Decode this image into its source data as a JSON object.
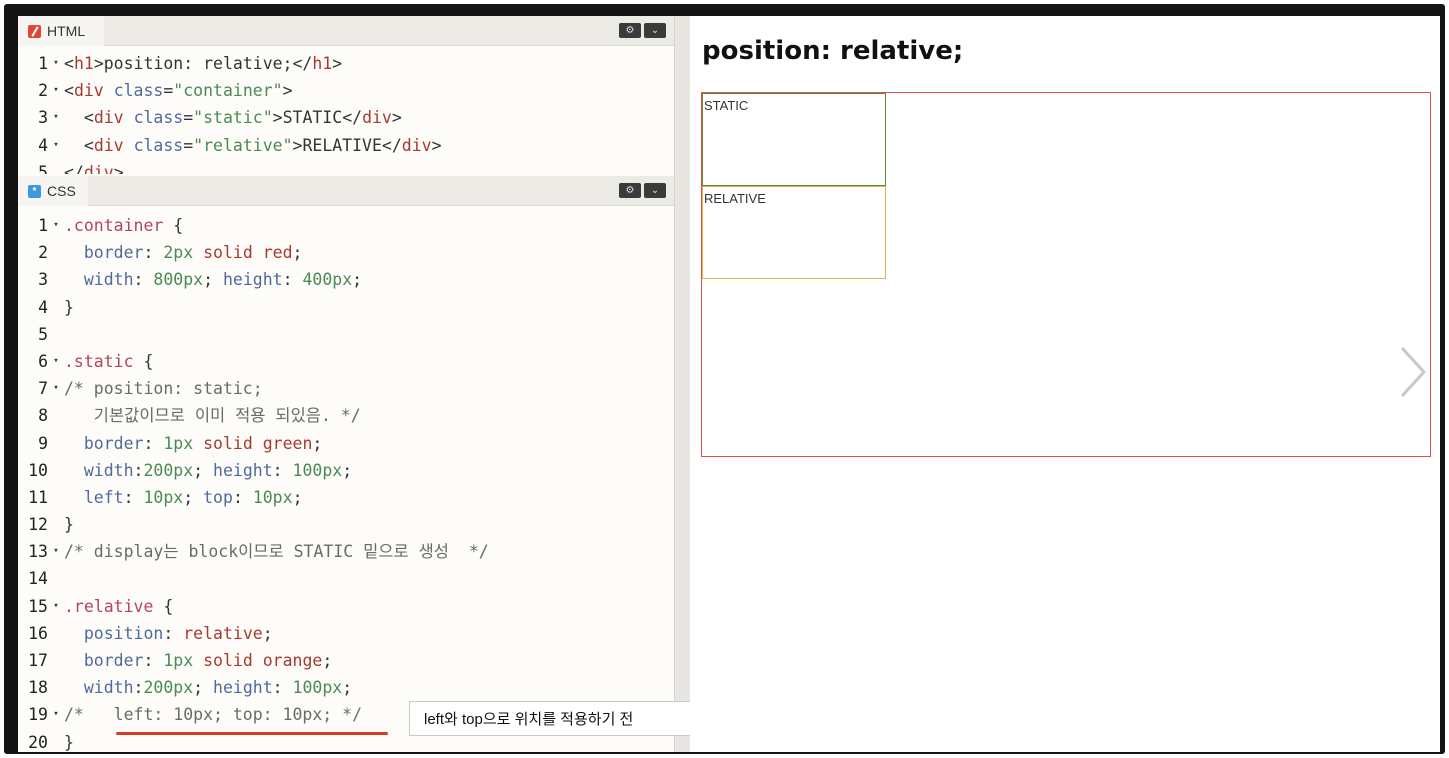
{
  "html_pane": {
    "tab_label": "HTML",
    "lines": [
      {
        "n": "1",
        "fold": "▾",
        "tokens": [
          [
            "t-plain",
            "<"
          ],
          [
            "t-tag",
            "h1"
          ],
          [
            "t-plain",
            ">position: relative;</"
          ],
          [
            "t-tag",
            "h1"
          ],
          [
            "t-plain",
            ">"
          ]
        ]
      },
      {
        "n": "2",
        "fold": "▾",
        "tokens": [
          [
            "t-plain",
            "<"
          ],
          [
            "t-tag",
            "div"
          ],
          [
            "t-plain",
            " "
          ],
          [
            "t-attr",
            "class"
          ],
          [
            "t-plain",
            "="
          ],
          [
            "t-str",
            "\"container\""
          ],
          [
            "t-plain",
            ">"
          ]
        ]
      },
      {
        "n": "3",
        "fold": "▾",
        "tokens": [
          [
            "t-plain",
            "  <"
          ],
          [
            "t-tag",
            "div"
          ],
          [
            "t-plain",
            " "
          ],
          [
            "t-attr",
            "class"
          ],
          [
            "t-plain",
            "="
          ],
          [
            "t-str",
            "\"static\""
          ],
          [
            "t-plain",
            ">STATIC</"
          ],
          [
            "t-tag",
            "div"
          ],
          [
            "t-plain",
            ">"
          ]
        ]
      },
      {
        "n": "4",
        "fold": "▾",
        "tokens": [
          [
            "t-plain",
            "  <"
          ],
          [
            "t-tag",
            "div"
          ],
          [
            "t-plain",
            " "
          ],
          [
            "t-attr",
            "class"
          ],
          [
            "t-plain",
            "="
          ],
          [
            "t-str",
            "\"relative\""
          ],
          [
            "t-plain",
            ">RELATIVE</"
          ],
          [
            "t-tag",
            "div"
          ],
          [
            "t-plain",
            ">"
          ]
        ]
      },
      {
        "n": "5",
        "fold": "",
        "tokens": [
          [
            "t-plain",
            "</"
          ],
          [
            "t-tag",
            "div"
          ],
          [
            "t-plain",
            ">"
          ]
        ]
      }
    ]
  },
  "css_pane": {
    "tab_label": "CSS",
    "lines": [
      {
        "n": "1",
        "fold": "▾",
        "tokens": [
          [
            "t-sel",
            ".container"
          ],
          [
            "t-plain",
            " {"
          ]
        ]
      },
      {
        "n": "2",
        "fold": "",
        "tokens": [
          [
            "t-plain",
            "  "
          ],
          [
            "t-prop",
            "border"
          ],
          [
            "t-plain",
            ": "
          ],
          [
            "t-num",
            "2px"
          ],
          [
            "t-plain",
            " "
          ],
          [
            "t-kw",
            "solid"
          ],
          [
            "t-plain",
            " "
          ],
          [
            "t-kw",
            "red"
          ],
          [
            "t-plain",
            ";"
          ]
        ]
      },
      {
        "n": "3",
        "fold": "",
        "tokens": [
          [
            "t-plain",
            "  "
          ],
          [
            "t-prop",
            "width"
          ],
          [
            "t-plain",
            ": "
          ],
          [
            "t-num",
            "800px"
          ],
          [
            "t-plain",
            "; "
          ],
          [
            "t-prop",
            "height"
          ],
          [
            "t-plain",
            ": "
          ],
          [
            "t-num",
            "400px"
          ],
          [
            "t-plain",
            ";"
          ]
        ]
      },
      {
        "n": "4",
        "fold": "",
        "tokens": [
          [
            "t-plain",
            "}"
          ]
        ]
      },
      {
        "n": "5",
        "fold": "",
        "tokens": []
      },
      {
        "n": "6",
        "fold": "▾",
        "tokens": [
          [
            "t-sel",
            ".static"
          ],
          [
            "t-plain",
            " {"
          ]
        ]
      },
      {
        "n": "7",
        "fold": "▾",
        "tokens": [
          [
            "t-com",
            "/* position: static;"
          ]
        ]
      },
      {
        "n": "8",
        "fold": "",
        "tokens": [
          [
            "t-com",
            "   기본값이므로 이미 적용 되있음. */"
          ]
        ]
      },
      {
        "n": "9",
        "fold": "",
        "tokens": [
          [
            "t-plain",
            "  "
          ],
          [
            "t-prop",
            "border"
          ],
          [
            "t-plain",
            ": "
          ],
          [
            "t-num",
            "1px"
          ],
          [
            "t-plain",
            " "
          ],
          [
            "t-kw",
            "solid"
          ],
          [
            "t-plain",
            " "
          ],
          [
            "t-kw",
            "green"
          ],
          [
            "t-plain",
            ";"
          ]
        ]
      },
      {
        "n": "10",
        "fold": "",
        "tokens": [
          [
            "t-plain",
            "  "
          ],
          [
            "t-prop",
            "width"
          ],
          [
            "t-plain",
            ":"
          ],
          [
            "t-num",
            "200px"
          ],
          [
            "t-plain",
            "; "
          ],
          [
            "t-prop",
            "height"
          ],
          [
            "t-plain",
            ": "
          ],
          [
            "t-num",
            "100px"
          ],
          [
            "t-plain",
            ";"
          ]
        ]
      },
      {
        "n": "11",
        "fold": "",
        "tokens": [
          [
            "t-plain",
            "  "
          ],
          [
            "t-prop",
            "left"
          ],
          [
            "t-plain",
            ": "
          ],
          [
            "t-num",
            "10px"
          ],
          [
            "t-plain",
            "; "
          ],
          [
            "t-prop",
            "top"
          ],
          [
            "t-plain",
            ": "
          ],
          [
            "t-num",
            "10px"
          ],
          [
            "t-plain",
            ";"
          ]
        ]
      },
      {
        "n": "12",
        "fold": "",
        "tokens": [
          [
            "t-plain",
            "}"
          ]
        ]
      },
      {
        "n": "13",
        "fold": "▾",
        "tokens": [
          [
            "t-com",
            "/* display는 block이므로 STATIC 밑으로 생성  */"
          ]
        ]
      },
      {
        "n": "14",
        "fold": "",
        "tokens": []
      },
      {
        "n": "15",
        "fold": "▾",
        "tokens": [
          [
            "t-sel",
            ".relative"
          ],
          [
            "t-plain",
            " {"
          ]
        ]
      },
      {
        "n": "16",
        "fold": "",
        "tokens": [
          [
            "t-plain",
            "  "
          ],
          [
            "t-prop",
            "position"
          ],
          [
            "t-plain",
            ": "
          ],
          [
            "t-kw",
            "relative"
          ],
          [
            "t-plain",
            ";"
          ]
        ]
      },
      {
        "n": "17",
        "fold": "",
        "tokens": [
          [
            "t-plain",
            "  "
          ],
          [
            "t-prop",
            "border"
          ],
          [
            "t-plain",
            ": "
          ],
          [
            "t-num",
            "1px"
          ],
          [
            "t-plain",
            " "
          ],
          [
            "t-kw",
            "solid"
          ],
          [
            "t-plain",
            " "
          ],
          [
            "t-kw",
            "orange"
          ],
          [
            "t-plain",
            ";"
          ]
        ]
      },
      {
        "n": "18",
        "fold": "",
        "tokens": [
          [
            "t-plain",
            "  "
          ],
          [
            "t-prop",
            "width"
          ],
          [
            "t-plain",
            ":"
          ],
          [
            "t-num",
            "200px"
          ],
          [
            "t-plain",
            "; "
          ],
          [
            "t-prop",
            "height"
          ],
          [
            "t-plain",
            ": "
          ],
          [
            "t-num",
            "100px"
          ],
          [
            "t-plain",
            ";"
          ]
        ]
      },
      {
        "n": "19",
        "fold": "▾",
        "tokens": [
          [
            "t-com",
            "/*   left: 10px; top: 10px; */"
          ]
        ]
      },
      {
        "n": "20",
        "fold": "",
        "tokens": [
          [
            "t-plain",
            "}"
          ]
        ]
      }
    ]
  },
  "pane_buttons": {
    "settings_icon": "gear-icon",
    "settings_glyph": "⚙",
    "collapse_icon": "chevron-down-icon",
    "collapse_glyph": "⌄"
  },
  "annotation": {
    "tooltip_text": "left와 top으로 위치를 적용하기 전"
  },
  "preview": {
    "heading": "position: relative;",
    "static_label": "STATIC",
    "relative_label": "RELATIVE",
    "next_icon": "chevron-right-icon"
  },
  "colors": {
    "container_border": "#e05050",
    "static_border": "#5a8a32",
    "relative_border": "#e2b15a",
    "annotation_underline": "#d23a2a"
  }
}
